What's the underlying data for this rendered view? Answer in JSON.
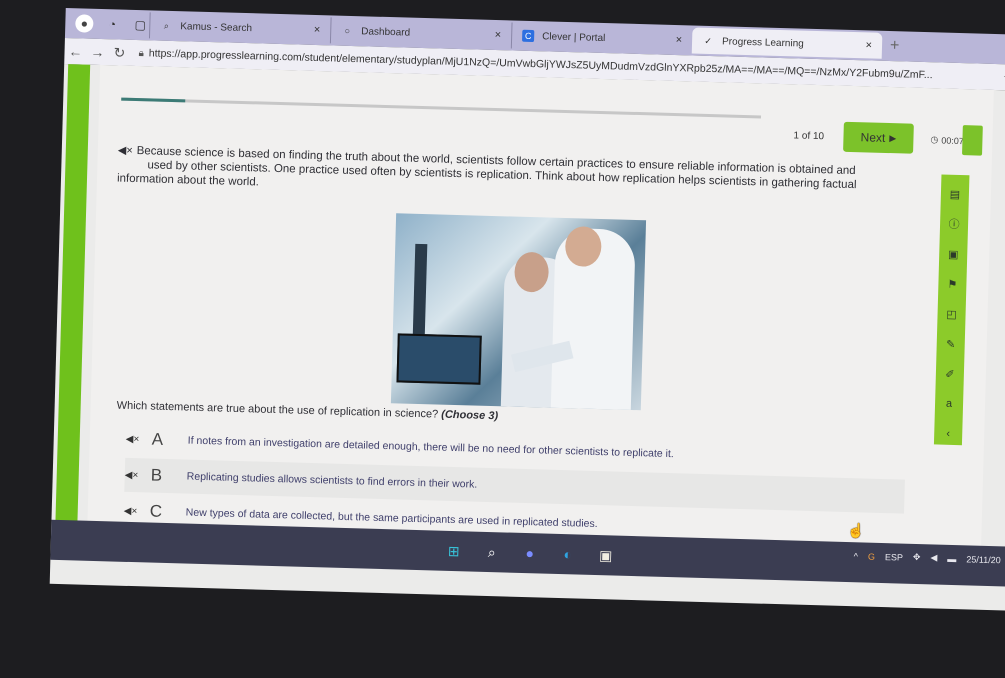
{
  "browser": {
    "tabs": [
      {
        "label": "Kamus - Search",
        "icon": "search-icon",
        "active": false
      },
      {
        "label": "Dashboard",
        "icon": "circle-icon",
        "active": false
      },
      {
        "label": "Clever | Portal",
        "icon": "clever-icon",
        "active": false
      },
      {
        "label": "Progress Learning",
        "icon": "progress-learning-icon",
        "active": true
      }
    ],
    "close_glyph": "×",
    "new_tab_glyph": "+",
    "url": "https://app.progresslearning.com/student/elementary/studyplan/MjU1NzQ=/UmVwbGljYWJsZ5UyMDudmVzdGlnYXRpb25z/MA==/MA==/MQ==/NzMx/Y2Fubm9u/ZmF..."
  },
  "quiz": {
    "progress": {
      "current": 1,
      "total": 10,
      "fraction": 0.1
    },
    "counter_text": "1 of 10",
    "next_label": "Next",
    "timer": "00:07",
    "passage": {
      "line1": "Because science is based on finding the truth about the world, scientists follow certain practices to ensure reliable information is obtained and",
      "line2": "used by other scientists. One practice used often by scientists is replication. Think about how replication helps scientists in gathering factual",
      "line3": "information about the world."
    },
    "image_alt": "Two scientists examining a tablet in a laboratory",
    "question": "Which statements are true about the use of replication in science?",
    "question_note": "(Choose 3)",
    "choices": [
      {
        "letter": "A",
        "text": "If notes from an investigation are detailed enough, there will be no need for other scientists to replicate it."
      },
      {
        "letter": "B",
        "text": "Replicating studies allows scientists to find errors in their work."
      },
      {
        "letter": "C",
        "text": "New types of data are collected, but the same participants are used in replicated studies."
      }
    ],
    "tools": [
      "calendar-icon",
      "info-icon",
      "notes-icon",
      "flag-icon",
      "note-icon",
      "pencil-icon",
      "highlighter-icon",
      "translate-icon",
      "collapse-icon"
    ]
  },
  "taskbar": {
    "apps": [
      "windows-start-icon",
      "search-icon",
      "chat-icon",
      "edge-icon",
      "store-icon"
    ],
    "tray": {
      "lang": "ESP",
      "date": "25/11/20"
    }
  }
}
